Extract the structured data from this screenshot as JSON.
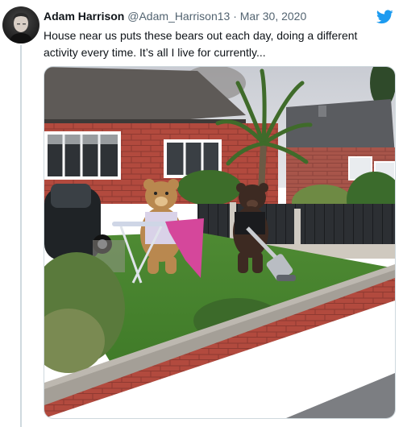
{
  "tweet": {
    "display_name": "Adam Harrison",
    "handle": "@Adam_Harrison13",
    "separator": "·",
    "date": "Mar 30, 2020",
    "text": "House near us puts these bears out each day, doing a different activity every time. It’s all I live for currently..."
  },
  "icons": {
    "platform_logo": "twitter-bird-icon"
  },
  "colors": {
    "accent": "#1d9bf0",
    "text": "#0f1419",
    "secondary_text": "#536471",
    "divider": "#cfd9de"
  }
}
